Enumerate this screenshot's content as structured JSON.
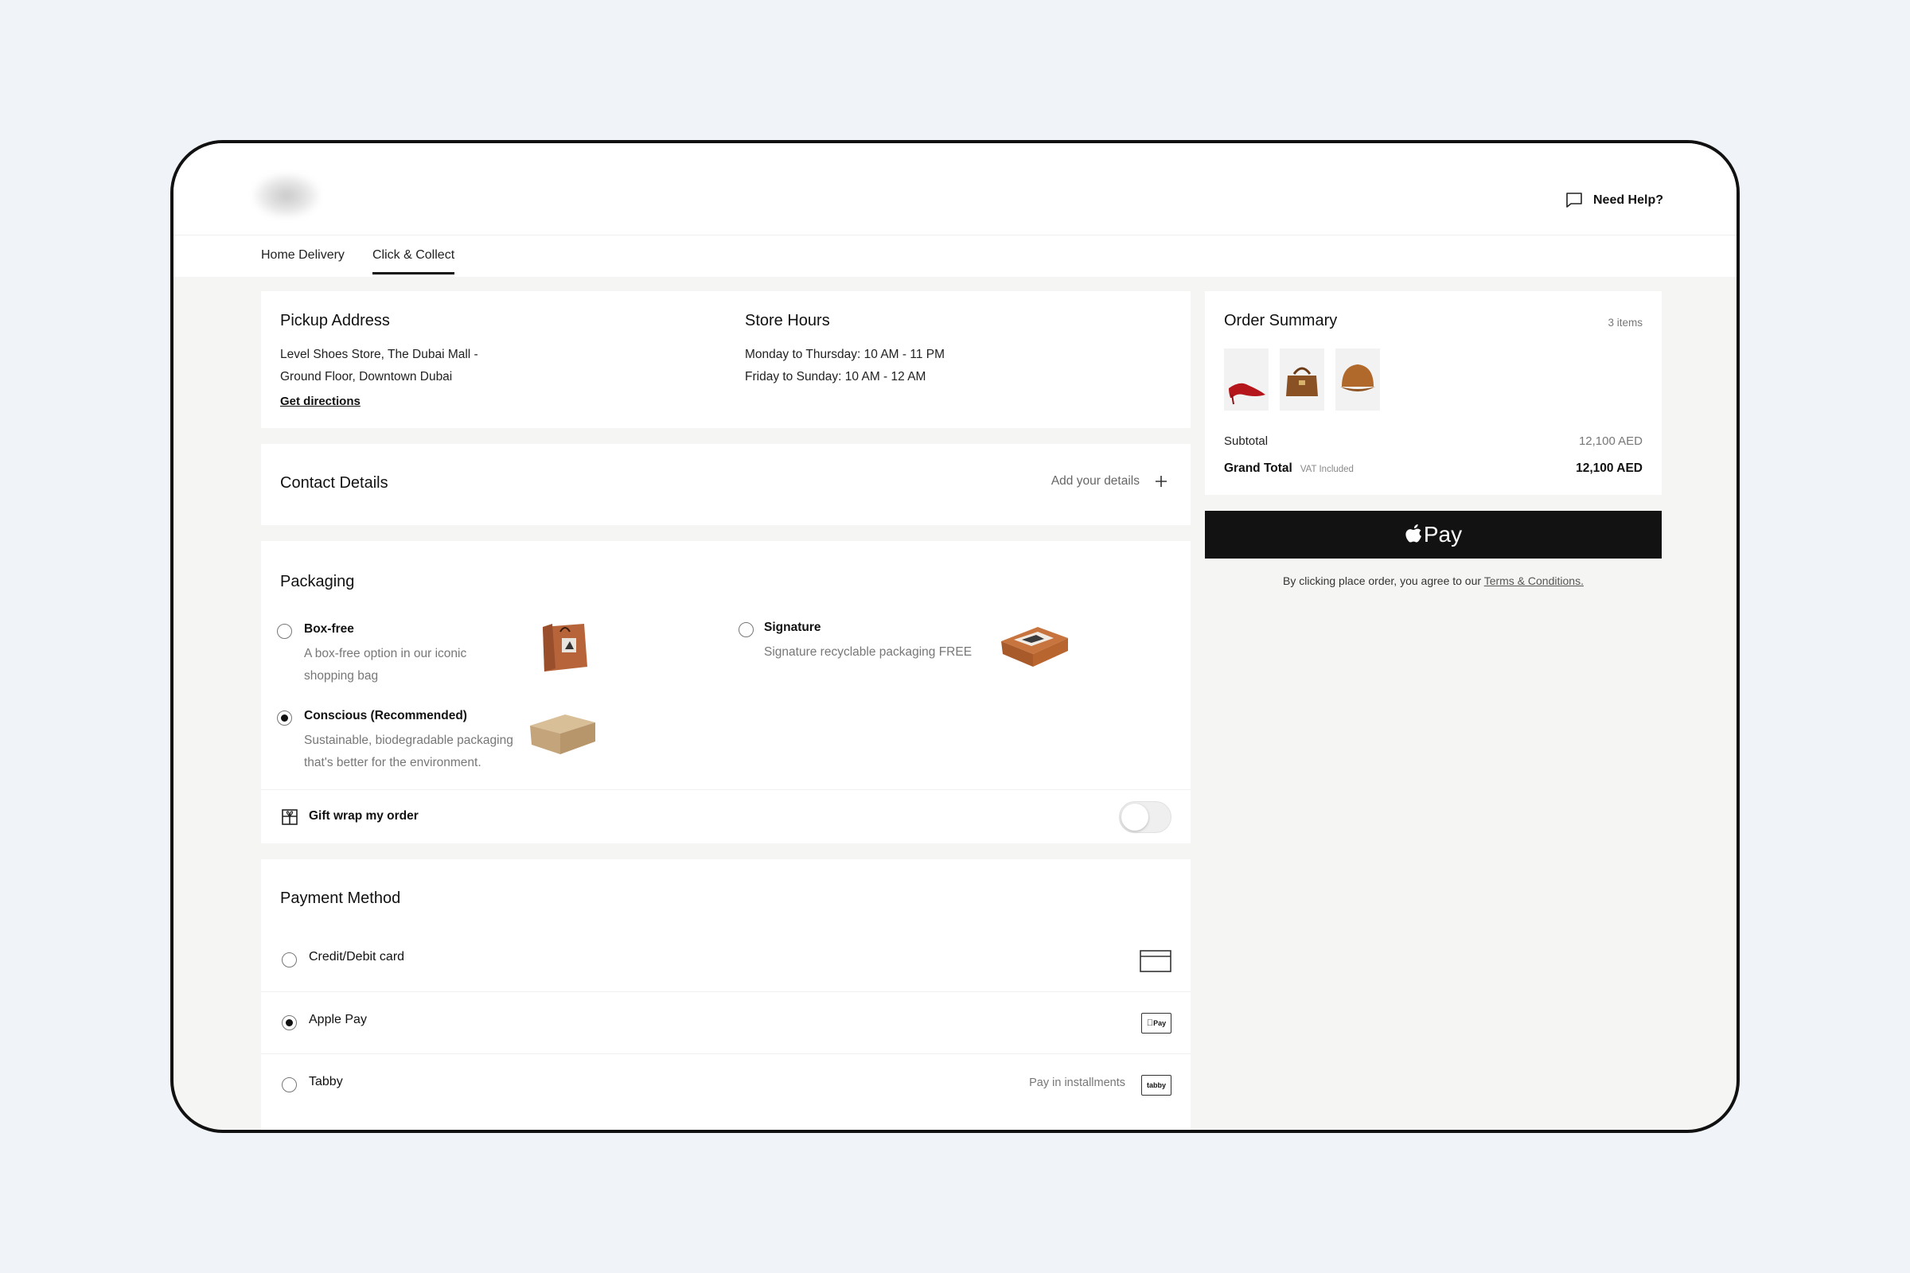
{
  "header": {
    "help_label": "Need Help?"
  },
  "tabs": [
    {
      "label": "Home Delivery",
      "active": false
    },
    {
      "label": "Click & Collect",
      "active": true
    }
  ],
  "pickup": {
    "title": "Pickup Address",
    "line1": "Level Shoes Store, The Dubai Mall -",
    "line2": "Ground Floor, Downtown Dubai",
    "directions": "Get directions"
  },
  "store_hours": {
    "title": "Store Hours",
    "line1": "Monday to Thursday: 10 AM - 11 PM",
    "line2": "Friday to Sunday: 10 AM - 12 AM"
  },
  "contact": {
    "title": "Contact Details",
    "action": "Add your details"
  },
  "packaging": {
    "title": "Packaging",
    "options": [
      {
        "title": "Box-free",
        "desc1": "A box-free option in our iconic",
        "desc2": "shopping bag",
        "selected": false
      },
      {
        "title": "Signature",
        "desc1": "Signature recyclable packaging FREE",
        "desc2": "",
        "selected": false
      },
      {
        "title": "Conscious (Recommended)",
        "desc1": "Sustainable, biodegradable packaging",
        "desc2": "that's better for the environment.",
        "selected": true
      }
    ],
    "gift_wrap_label": "Gift wrap my order",
    "gift_wrap_on": false
  },
  "payment": {
    "title": "Payment Method",
    "methods": [
      {
        "label": "Credit/Debit card",
        "selected": false,
        "icon": "credit-card-icon",
        "note": ""
      },
      {
        "label": "Apple Pay",
        "selected": true,
        "icon": "apple-pay-icon",
        "icon_text": "Pay",
        "note": ""
      },
      {
        "label": "Tabby",
        "selected": false,
        "icon": "tabby-icon",
        "icon_text": "tabby",
        "note": "Pay in installments"
      }
    ]
  },
  "summary": {
    "title": "Order Summary",
    "count": "3 items",
    "subtotal_label": "Subtotal",
    "subtotal_value": "12,100 AED",
    "total_label": "Grand Total",
    "vat_note": "VAT Included",
    "total_value": "12,100 AED",
    "items": [
      "red-heel-shoe",
      "brown-handbag",
      "brown-cap"
    ]
  },
  "apple_pay_button": {
    "label": "Pay"
  },
  "terms": {
    "prefix": "By clicking place order, you agree to our",
    "link": "Terms & Conditions."
  },
  "colors": {
    "accent": "#111111",
    "background": "#f5f5f3",
    "page": "#f0f3f8"
  }
}
